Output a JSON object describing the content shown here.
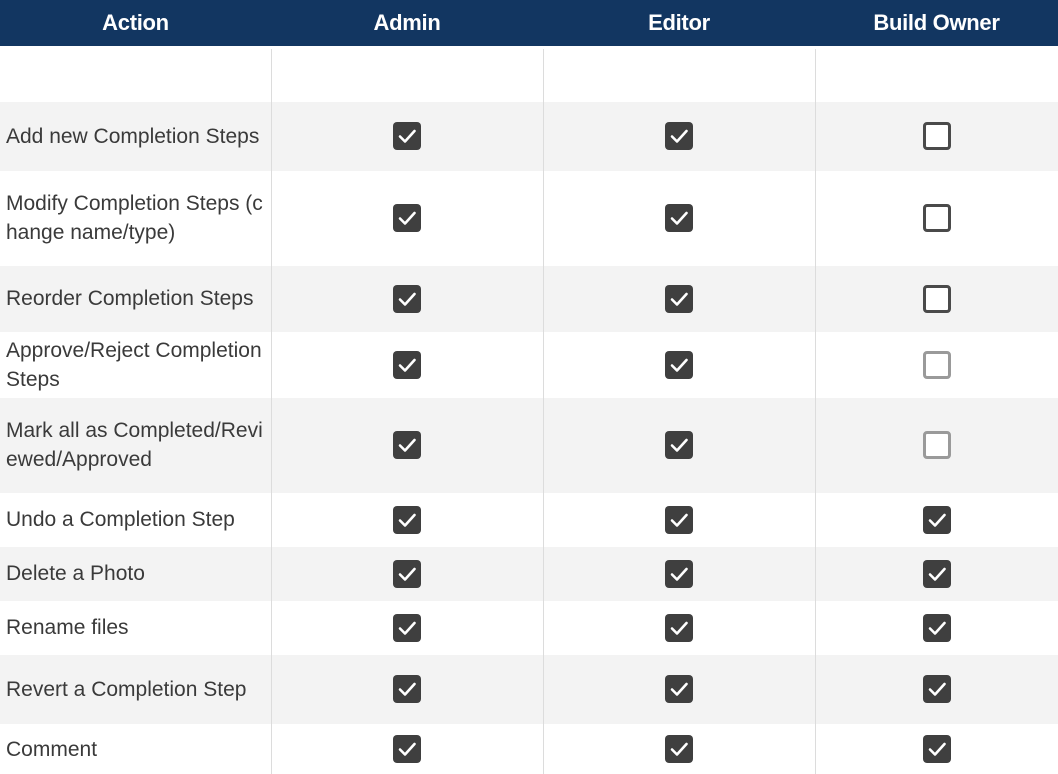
{
  "headers": [
    "Action",
    "Admin",
    "Editor",
    "Build Owner"
  ],
  "rows": [
    {
      "action": "",
      "admin": null,
      "editor": null,
      "owner": null
    },
    {
      "action": "Add new Completion Steps",
      "admin": true,
      "editor": true,
      "owner": false
    },
    {
      "action": "Modify Completion Steps (change name/type)",
      "admin": true,
      "editor": true,
      "owner": false
    },
    {
      "action": "Reorder Completion Steps",
      "admin": true,
      "editor": true,
      "owner": false
    },
    {
      "action": "Approve/Reject Completion Steps",
      "admin": true,
      "editor": true,
      "owner": false
    },
    {
      "action": "Mark all as Completed/Reviewed/Approved",
      "admin": true,
      "editor": true,
      "owner": false
    },
    {
      "action": "Undo a Completion Step",
      "admin": true,
      "editor": true,
      "owner": true
    },
    {
      "action": "Delete a Photo",
      "admin": true,
      "editor": true,
      "owner": true
    },
    {
      "action": "Rename files",
      "admin": true,
      "editor": true,
      "owner": true
    },
    {
      "action": "Revert a Completion Step",
      "admin": true,
      "editor": true,
      "owner": true
    },
    {
      "action": "Comment",
      "admin": true,
      "editor": true,
      "owner": true
    }
  ],
  "colors": {
    "header_bg": "#123661",
    "header_text": "#ffffff",
    "checked_box": "#3f3f3f",
    "row_stripe": "#f3f3f3"
  },
  "icons": {
    "checked": "checked-checkbox-icon",
    "unchecked": "unchecked-checkbox-icon"
  }
}
